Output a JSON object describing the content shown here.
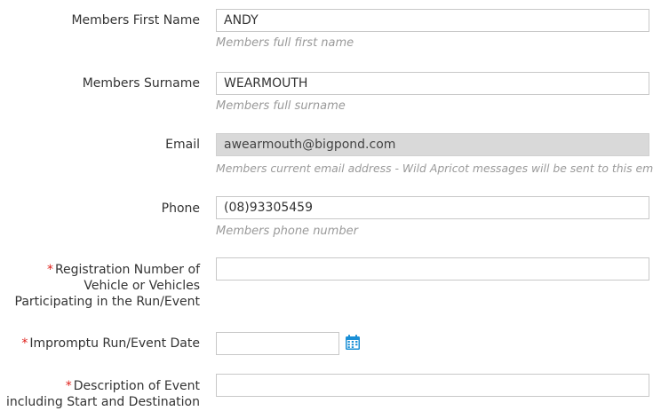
{
  "fields": {
    "first_name": {
      "label": "Members First Name",
      "value": "ANDY",
      "help": "Members full first name"
    },
    "surname": {
      "label": "Members Surname",
      "value": "WEARMOUTH",
      "help": "Members full surname"
    },
    "email": {
      "label": "Email",
      "value": "awearmouth@bigpond.com",
      "help": "Members current email address - Wild Apricot messages will be sent to this email"
    },
    "phone": {
      "label": "Phone",
      "value": "(08)93305459",
      "help": "Members phone number"
    },
    "registration": {
      "required_mark": "*",
      "label_line1": "Registration Number of",
      "label_line2": "Vehicle or Vehicles",
      "label_line3": "Participating in the Run/Event",
      "value": ""
    },
    "event_date": {
      "required_mark": "*",
      "label": "Impromptu Run/Event Date",
      "value": "",
      "calendar_icon": "calendar-icon"
    },
    "description": {
      "required_mark": "*",
      "label_line1": "Description of Event",
      "label_line2": "including Start and Destination",
      "value": ""
    }
  },
  "colors": {
    "required": "#e0201b",
    "help_text": "#9a9a9a",
    "disabled_bg": "#d9d9d9",
    "calendar_icon": "#1a8fd6"
  }
}
